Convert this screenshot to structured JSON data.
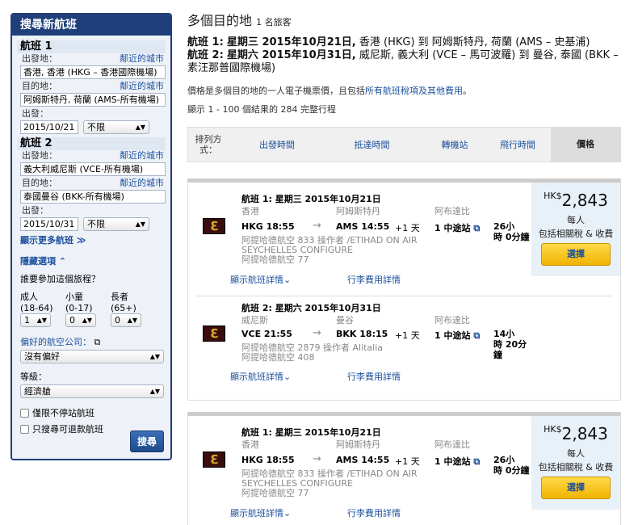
{
  "sidebar": {
    "header": "搜尋新航班",
    "flight1": {
      "label": "航班 1",
      "from_label": "出發地：",
      "nearby": "鄰近的城市",
      "from_value": "香港, 香港 (HKG – 香港國際機場)",
      "to_label": "目的地：",
      "to_value": "阿姆斯特丹, 荷蘭 (AMS-所有機場)",
      "depart_label": "出發：",
      "date": "2015/10/21",
      "time": "不限"
    },
    "flight2": {
      "label": "航班 2",
      "from_label": "出發地：",
      "nearby": "鄰近的城市",
      "from_value": "義大利威尼斯 (VCE-所有機場)",
      "to_label": "目的地：",
      "to_value": "泰國曼谷 (BKK-所有機場)",
      "depart_label": "出發：",
      "date": "2015/10/31",
      "time": "不限"
    },
    "more_flights": "顯示更多航班",
    "hide_options": "隱藏選項",
    "who_travels": "誰要參加這個旅程？",
    "pax": [
      {
        "label": "成人",
        "range": "(18-64)",
        "value": "1"
      },
      {
        "label": "小童",
        "range": "(0-17)",
        "value": "0"
      },
      {
        "label": "長者",
        "range": "(65+)",
        "value": "0"
      }
    ],
    "airline_label": "偏好的航空公司：",
    "airline_value": "沒有偏好",
    "class_label": "等級：",
    "class_value": "經濟艙",
    "nonstop": "僅限不停站航班",
    "refundable": "只搜尋可退款航班",
    "search_btn": "搜尋"
  },
  "main": {
    "title": "多個目的地",
    "travelers": "1 名旅客",
    "f1_label": "航班 1:",
    "f1_date": "星期三 2015年10月21日,",
    "f1_route": "香港 (HKG) 到 阿姆斯特丹, 荷蘭 (AMS – 史基浦)",
    "f2_label": "航班 2:",
    "f2_date": "星期六 2015年10月31日,",
    "f2_route": "威尼斯, 義大利 (VCE – 馬可波羅) 到 曼谷, 泰國 (BKK – 素汪那普國際機場)",
    "note_text": "價格是多個目的地的一人電子機票價，且包括",
    "note_link": "所有航班稅項及其他費用",
    "note_end": "。",
    "count": "顯示 1 - 100 個結果的 284 完整行程",
    "sort": {
      "label": "排列方式：",
      "items": [
        "出發時間",
        "抵達時間",
        "轉機站",
        "飛行時間"
      ],
      "price": "價格"
    }
  },
  "results": [
    {
      "legs": [
        {
          "header": "航班 1:  星期三 2015年10月21日",
          "from_city": "香港",
          "to_city": "阿姆斯特丹",
          "via_city": "阿布達比",
          "dep": "HKG  18:55",
          "arr": "AMS  14:55",
          "plus": "+1 天",
          "stops": "1 中途站",
          "dur1": "26小",
          "dur2": "時 0分鐘",
          "op1": "阿提哈德航空 833 操作者 /ETIHAD ON AIR",
          "op2": "SEYCHELLES CONFIGURE",
          "op3": "阿提哈德航空 77",
          "details": "顯示航班詳情",
          "baggage": "行李費用詳情"
        },
        {
          "header": "航班 2:  星期六 2015年10月31日",
          "from_city": "威尼斯",
          "to_city": "曼谷",
          "via_city": "阿布達比",
          "dep": "VCE  21:55",
          "arr": "BKK  18:15",
          "plus": "+1 天",
          "stops": "1 中途站",
          "dur1": "14小",
          "dur2": "時 20分",
          "dur3": "鐘",
          "op1": "阿提哈德航空 2879 操作者 Alitalia",
          "op2": "阿提哈德航空 408",
          "op3": "",
          "details": "顯示航班詳情",
          "baggage": "行李費用詳情"
        }
      ],
      "currency": "HK$",
      "price": "2,843",
      "per": "每人",
      "incl": "包括相關稅 & 收費",
      "select": "選擇"
    },
    {
      "legs": [
        {
          "header": "航班 1:  星期三 2015年10月21日",
          "from_city": "香港",
          "to_city": "阿姆斯特丹",
          "via_city": "阿布達比",
          "dep": "HKG  18:55",
          "arr": "AMS  14:55",
          "plus": "+1 天",
          "stops": "1 中途站",
          "dur1": "26小",
          "dur2": "時 0分鐘",
          "op1": "阿提哈德航空 833 操作者 /ETIHAD ON AIR",
          "op2": "SEYCHELLES CONFIGURE",
          "op3": "阿提哈德航空 77",
          "details": "顯示航班詳情",
          "baggage": "行李費用詳情"
        }
      ],
      "currency": "HK$",
      "price": "2,843",
      "per": "每人",
      "incl": "包括相關稅 & 收費",
      "select": "選擇"
    }
  ]
}
